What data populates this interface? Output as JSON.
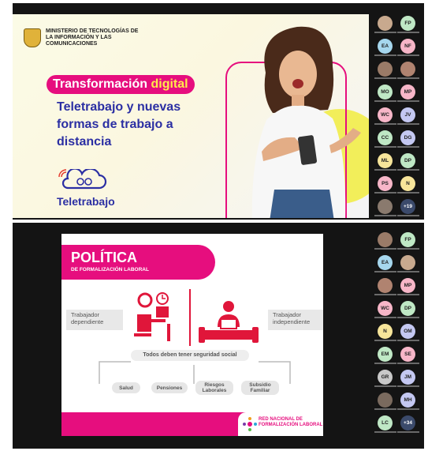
{
  "slide1": {
    "ministry": "MINISTERIO DE TECNOLOGÍAS DE LA INFORMACIÓN Y LAS COMUNICACIONES",
    "badge_prefix": "Transformación ",
    "badge_highlight": "digital",
    "heading": "Teletrabajo y nuevas formas de trabajo a distancia",
    "logo_text": "Teletrabajo"
  },
  "slide2": {
    "title": "POLÍTICA",
    "subtitle": "DE FORMALIZACIÓN LABORAL",
    "left_box": "Trabajador dependiente",
    "right_box": "Trabajador independiente",
    "center_box": "Todos deben tener seguridad social",
    "pills": [
      "Salud",
      "Pensiones",
      "Riesgos Laborales",
      "Subsidio Familiar"
    ],
    "network": "RED NACIONAL DE FORMALIZACIÓN LABORAL"
  },
  "participants_top": [
    {
      "initials": "",
      "color": "#c8a98e"
    },
    {
      "initials": "FP",
      "color": "#bfe8c5"
    },
    {
      "initials": "EA",
      "color": "#a6d7ee"
    },
    {
      "initials": "NF",
      "color": "#f7b6c8"
    },
    {
      "initials": "",
      "color": "#9a7b68"
    },
    {
      "initials": "",
      "color": "#b08370"
    },
    {
      "initials": "MO",
      "color": "#bfe8c5"
    },
    {
      "initials": "MP",
      "color": "#f7b6c8"
    },
    {
      "initials": "WC",
      "color": "#f7b6c8"
    },
    {
      "initials": "JV",
      "color": "#c4c8f2"
    },
    {
      "initials": "CC",
      "color": "#bfe8c5"
    },
    {
      "initials": "DG",
      "color": "#c4c8f2"
    },
    {
      "initials": "ML",
      "color": "#f7e59a"
    },
    {
      "initials": "DP",
      "color": "#bfe8c5"
    },
    {
      "initials": "PS",
      "color": "#f7b6c8"
    },
    {
      "initials": "N",
      "color": "#f7e59a"
    },
    {
      "initials": "",
      "color": "#8a7a6e"
    },
    {
      "initials": "+19",
      "color": "#3b4a6b"
    }
  ],
  "participants_bottom": [
    {
      "initials": "",
      "color": "#9a7b68"
    },
    {
      "initials": "FP",
      "color": "#bfe8c5"
    },
    {
      "initials": "EA",
      "color": "#a6d7ee"
    },
    {
      "initials": "",
      "color": "#c8a98e"
    },
    {
      "initials": "",
      "color": "#b08370"
    },
    {
      "initials": "MP",
      "color": "#f7b6c8"
    },
    {
      "initials": "WC",
      "color": "#f7b6c8"
    },
    {
      "initials": "DP",
      "color": "#bfe8c5"
    },
    {
      "initials": "N",
      "color": "#f7e59a"
    },
    {
      "initials": "OM",
      "color": "#c4c8f2"
    },
    {
      "initials": "EM",
      "color": "#bfe8c5"
    },
    {
      "initials": "SE",
      "color": "#f7b6c8"
    },
    {
      "initials": "GR",
      "color": "#c9c9c9"
    },
    {
      "initials": "JM",
      "color": "#c4c8f2"
    },
    {
      "initials": "",
      "color": "#7a6a5e"
    },
    {
      "initials": "MH",
      "color": "#c4c8f2"
    },
    {
      "initials": "LC",
      "color": "#bfe8c5"
    },
    {
      "initials": "+34",
      "color": "#3b4a6b"
    }
  ]
}
